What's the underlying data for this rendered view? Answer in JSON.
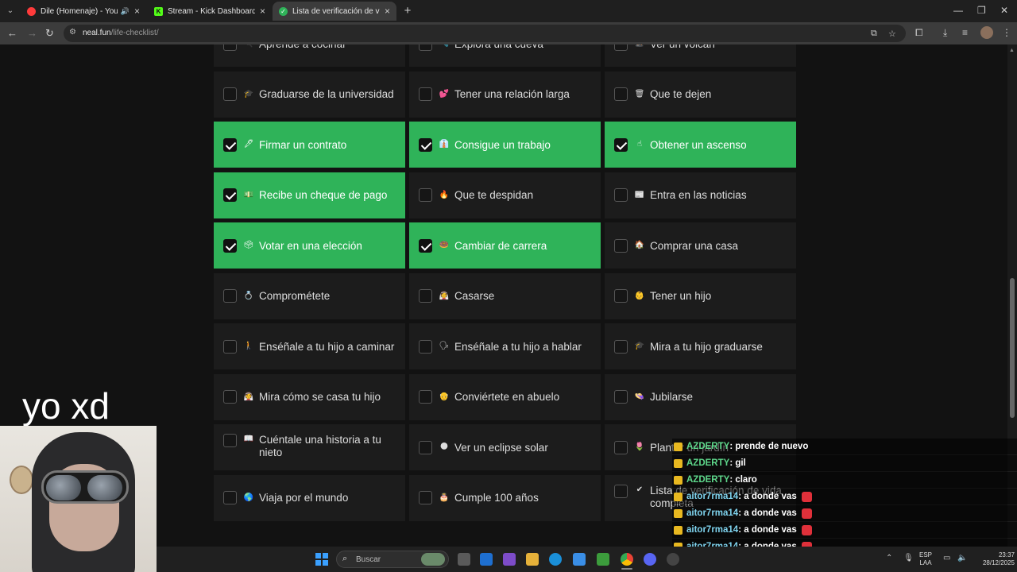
{
  "tabs": [
    {
      "title": "Dile (Homenaje) - YouTube",
      "color": "#ff3b3b"
    },
    {
      "title": "Stream - Kick Dashboard",
      "color": "#53fc18"
    },
    {
      "title": "Lista de verificación de vida",
      "color": "#2fb359"
    }
  ],
  "address": {
    "domain": "neal.fun",
    "path": "/life-checklist/"
  },
  "cells": [
    {
      "label": "Aprende a cocinar",
      "emoji": "🍳",
      "checked": false
    },
    {
      "label": "Explora una cueva",
      "emoji": "🔦",
      "checked": false
    },
    {
      "label": "Ver un volcán",
      "emoji": "🌋",
      "checked": false
    },
    {
      "label": "Graduarse de la universidad",
      "emoji": "🎓",
      "checked": false
    },
    {
      "label": "Tener una relación larga",
      "emoji": "💕",
      "checked": false
    },
    {
      "label": "Que te dejen",
      "emoji": "🗑",
      "checked": false
    },
    {
      "label": "Firmar un contrato",
      "emoji": "🖋",
      "checked": true
    },
    {
      "label": "Consigue un trabajo",
      "emoji": "👔",
      "checked": true
    },
    {
      "label": "Obtener un ascenso",
      "emoji": "☝",
      "checked": true
    },
    {
      "label": "Recibe un cheque de pago",
      "emoji": "💵",
      "checked": true
    },
    {
      "label": "Que te despidan",
      "emoji": "🔥",
      "checked": false
    },
    {
      "label": "Entra en las noticias",
      "emoji": "📰",
      "checked": false
    },
    {
      "label": "Votar en una elección",
      "emoji": "🗳",
      "checked": true
    },
    {
      "label": "Cambiar de carrera",
      "emoji": "🍩",
      "checked": true
    },
    {
      "label": "Comprar una casa",
      "emoji": "🏠",
      "checked": false
    },
    {
      "label": "Comprométete",
      "emoji": "💍",
      "checked": false
    },
    {
      "label": "Casarse",
      "emoji": "👰",
      "checked": false
    },
    {
      "label": "Tener un hijo",
      "emoji": "👶",
      "checked": false
    },
    {
      "label": "Enséñale a tu hijo a caminar",
      "emoji": "🚶",
      "checked": false
    },
    {
      "label": "Enséñale a tu hijo a hablar",
      "emoji": "🗣",
      "checked": false
    },
    {
      "label": "Mira a tu hijo graduarse",
      "emoji": "🎓",
      "checked": false
    },
    {
      "label": "Mira cómo se casa tu hijo",
      "emoji": "👰",
      "checked": false
    },
    {
      "label": "Conviértete en abuelo",
      "emoji": "👴",
      "checked": false
    },
    {
      "label": "Jubilarse",
      "emoji": "👒",
      "checked": false
    },
    {
      "label": "Cuéntale una historia a tu nieto",
      "emoji": "📖",
      "checked": false
    },
    {
      "label": "Ver un eclipse solar",
      "emoji": "🌑",
      "checked": false
    },
    {
      "label": "Plantar un jardín",
      "emoji": "🌷",
      "checked": false
    },
    {
      "label": "Viaja por el mundo",
      "emoji": "🌎",
      "checked": false
    },
    {
      "label": "Cumple 100 años",
      "emoji": "🎂",
      "checked": false
    },
    {
      "label": "Lista de verificación de vida completa",
      "emoji": "✔",
      "checked": false
    }
  ],
  "webcam": {
    "caption": "yo xd"
  },
  "chat": [
    {
      "user": "AZDERTY",
      "text": ": prende de nuevo",
      "emote": false,
      "style": "user1"
    },
    {
      "user": "AZDERTY",
      "text": ": gil",
      "emote": false,
      "style": "user1"
    },
    {
      "user": "AZDERTY",
      "text": ": claro",
      "emote": false,
      "style": "user1"
    },
    {
      "user": "aitor7rma14",
      "text": ": a donde vas",
      "emote": true,
      "style": "user2"
    },
    {
      "user": "aitor7rma14",
      "text": ": a donde vas",
      "emote": true,
      "style": "user2"
    },
    {
      "user": "aitor7rma14",
      "text": ": a donde vas",
      "emote": true,
      "style": "user2"
    },
    {
      "user": "aitor7rma14",
      "text": ": a donde vas",
      "emote": true,
      "style": "user2"
    },
    {
      "user": "aitor7rma14",
      "text": ": a donde vas",
      "emote": true,
      "style": "user2"
    }
  ],
  "taskbar": {
    "search_placeholder": "Buscar",
    "lang_top": "ESP",
    "lang_bottom": "LAA",
    "time": "23:37",
    "date": "28/12/2025"
  }
}
